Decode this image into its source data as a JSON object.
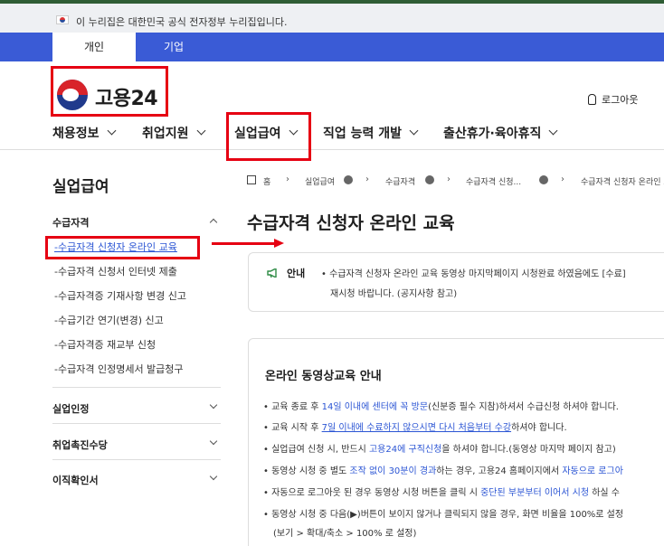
{
  "gov_banner": {
    "text": "이 누리집은 대한민국 공식 전자정부 누리집입니다."
  },
  "tabs": [
    {
      "label": "개인"
    },
    {
      "label": "기업"
    }
  ],
  "logo": {
    "text": "고용24"
  },
  "utility": {
    "logout": "로그아웃"
  },
  "gnb": [
    {
      "label": "채용정보"
    },
    {
      "label": "취업지원"
    },
    {
      "label": "실업급여"
    },
    {
      "label": "직업 능력 개발"
    },
    {
      "label": "출산휴가·육아휴직"
    }
  ],
  "lnb": {
    "title": "실업급여",
    "sections": [
      {
        "label": "수급자격"
      },
      {
        "label": "실업인정"
      },
      {
        "label": "취업촉진수당"
      },
      {
        "label": "이직확인서"
      }
    ],
    "sub_items": [
      {
        "label": "수급자격 신청자 온라인 교육"
      },
      {
        "label": "수급자격 신청서 인터넷 제출"
      },
      {
        "label": "수급자격증 기재사항 변경 신고"
      },
      {
        "label": "수급기간 연기(변경) 신고"
      },
      {
        "label": "수급자격증 재교부 신청"
      },
      {
        "label": "수급자격 인정명세서 발급청구"
      }
    ]
  },
  "breadcrumb": [
    "홈",
    "실업급여",
    "수급자격",
    "수급자격 신청...",
    "수급자격 신청자 온라인 교육"
  ],
  "page_title": "수급자격 신청자 온라인 교육",
  "notice": {
    "label": "안내",
    "line1": "수급자격 신청자 온라인 교육 동영상 마지막페이지 시청완료 하였음에도 [수료]",
    "line2": "재시청 바랍니다. (공지사항 참고)"
  },
  "guide": {
    "title": "온라인 동영상교육 안내",
    "items": [
      {
        "a": "교육 종료 후 ",
        "b": "14일 이내에 센터에 꼭 방문",
        "c": "(신분증 필수 지참)하셔서 수급신청 하셔야 합니다."
      },
      {
        "a": "교육 시작 후 ",
        "b": "7일 이내에 수료하지 않으시면 다시 처음부터 수강",
        "c": "하셔야 합니다."
      },
      {
        "a": "실업급여 신청 시, 반드시 ",
        "b": "고용24에 구직신청",
        "c": "을 하셔야 합니다.(동영상 마지막 페이지 참고)"
      },
      {
        "a": "동영상 시청 중 별도 ",
        "b": "조작 없이 30분이 경과",
        "c": "하는 경우, 고용24 홈페이지에서 ",
        "d": "자동으로 로그아"
      },
      {
        "a": "자동으로 로그아웃 된 경우 동영상 시청 버튼을 클릭 시 ",
        "b": "중단된 부분부터 이어서 시청",
        "c": " 하실 수"
      },
      {
        "a": "동영상 시청 중 다음(▶)버튼이 보이지 않거나 클릭되지 않을 경우, 화면 비율을 100%로 설정"
      },
      {
        "a": "(보기 > 확대/축소 > 100% 로 설정)"
      }
    ]
  },
  "colors": {
    "brand_blue": "#3a5bd6",
    "link_blue": "#2b55d4",
    "annotation_red": "#e60012"
  }
}
